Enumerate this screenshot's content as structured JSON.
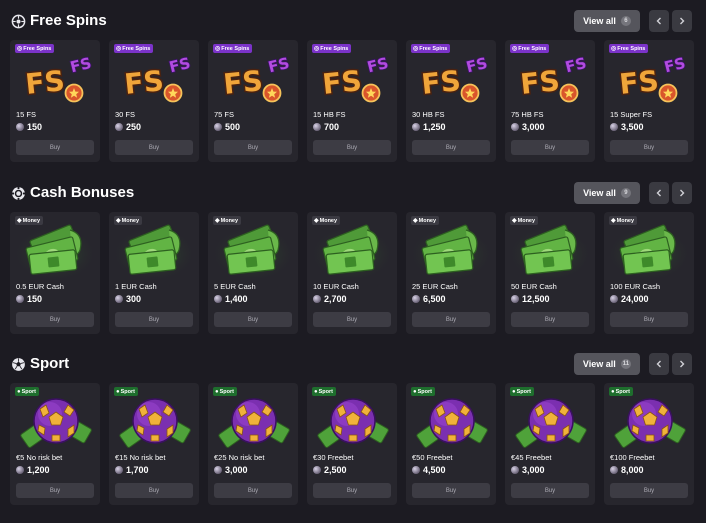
{
  "sections": [
    {
      "title": "Free Spins",
      "icon": "spin-wheel-icon",
      "view_all_label": "View all",
      "count": "6",
      "tag_icon": "free-spins-tag-icon",
      "items": [
        {
          "tag": "Free Spins",
          "name": "15 FS",
          "price": "150",
          "buy": "Buy"
        },
        {
          "tag": "Free Spins",
          "name": "30 FS",
          "price": "250",
          "buy": "Buy"
        },
        {
          "tag": "Free Spins",
          "name": "75 FS",
          "price": "500",
          "buy": "Buy"
        },
        {
          "tag": "Free Spins",
          "name": "15 HB FS",
          "price": "700",
          "buy": "Buy"
        },
        {
          "tag": "Free Spins",
          "name": "30 HB FS",
          "price": "1,250",
          "buy": "Buy"
        },
        {
          "tag": "Free Spins",
          "name": "75 HB FS",
          "price": "3,000",
          "buy": "Buy"
        },
        {
          "tag": "Free Spins",
          "name": "15 Super FS",
          "price": "3,500",
          "buy": "Buy"
        }
      ]
    },
    {
      "title": "Cash Bonuses",
      "icon": "poker-chip-icon",
      "view_all_label": "View all",
      "count": "9",
      "tag_icon": "money-tag-icon",
      "items": [
        {
          "tag": "Money",
          "name": "0.5 EUR Cash",
          "price": "150",
          "buy": "Buy"
        },
        {
          "tag": "Money",
          "name": "1 EUR Cash",
          "price": "300",
          "buy": "Buy"
        },
        {
          "tag": "Money",
          "name": "5 EUR Cash",
          "price": "1,400",
          "buy": "Buy"
        },
        {
          "tag": "Money",
          "name": "10 EUR Cash",
          "price": "2,700",
          "buy": "Buy"
        },
        {
          "tag": "Money",
          "name": "25 EUR Cash",
          "price": "6,500",
          "buy": "Buy"
        },
        {
          "tag": "Money",
          "name": "50 EUR Cash",
          "price": "12,500",
          "buy": "Buy"
        },
        {
          "tag": "Money",
          "name": "100 EUR Cash",
          "price": "24,000",
          "buy": "Buy"
        }
      ]
    },
    {
      "title": "Sport",
      "icon": "soccer-ball-icon",
      "view_all_label": "View all",
      "count": "11",
      "tag_icon": "sport-tag-icon",
      "items": [
        {
          "tag": "Sport",
          "name": "€5 No risk bet",
          "price": "1,200",
          "buy": "Buy"
        },
        {
          "tag": "Sport",
          "name": "€15 No risk bet",
          "price": "1,700",
          "buy": "Buy"
        },
        {
          "tag": "Sport",
          "name": "€25 No risk bet",
          "price": "3,000",
          "buy": "Buy"
        },
        {
          "tag": "Sport",
          "name": "€30 Freebet",
          "price": "2,500",
          "buy": "Buy"
        },
        {
          "tag": "Sport",
          "name": "€50 Freebet",
          "price": "4,500",
          "buy": "Buy"
        },
        {
          "tag": "Sport",
          "name": "€45 Freebet",
          "price": "3,000",
          "buy": "Buy"
        },
        {
          "tag": "Sport",
          "name": "€100 Freebet",
          "price": "8,000",
          "buy": "Buy"
        }
      ]
    }
  ],
  "art": {
    "fs_text": "FS"
  },
  "nav": {
    "prev_icon": "chevron-left-icon",
    "next_icon": "chevron-right-icon"
  },
  "colors": {
    "background": "#1c1b22",
    "card": "#27262d",
    "free_spins_tag": "#7b33c9",
    "sport_tag": "#1e6e2d",
    "view_all_button": "#55555c"
  }
}
